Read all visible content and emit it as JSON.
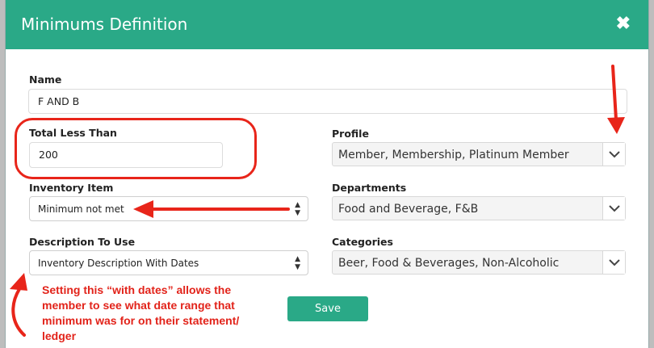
{
  "modal": {
    "title": "Minimums Definition",
    "close_symbol": "✖"
  },
  "form": {
    "name": {
      "label": "Name",
      "value": "F AND B"
    },
    "total_less_than": {
      "label": "Total Less Than",
      "value": "200"
    },
    "inventory_item": {
      "label": "Inventory Item",
      "selected": "Minimum not met"
    },
    "description_to_use": {
      "label": "Description To Use",
      "selected": "Inventory Description With Dates"
    },
    "profile": {
      "label": "Profile",
      "selected": "Member, Membership, Platinum Member"
    },
    "departments": {
      "label": "Departments",
      "selected": "Food and Beverage, F&B"
    },
    "categories": {
      "label": "Categories",
      "selected": "Beer, Food & Beverages, Non-Alcoholic"
    },
    "save_label": "Save"
  },
  "annotation": {
    "text": "Setting this “with dates” allows the member to see what date range that minimum was for on their statement/ ledger",
    "color": "#e2231a"
  },
  "colors": {
    "header": "#2aa987",
    "accent_red": "#e8251a"
  },
  "icons": {
    "close": "close-icon",
    "chevron": "chevron-down-icon",
    "select_arrows": "updown-arrows-icon"
  }
}
